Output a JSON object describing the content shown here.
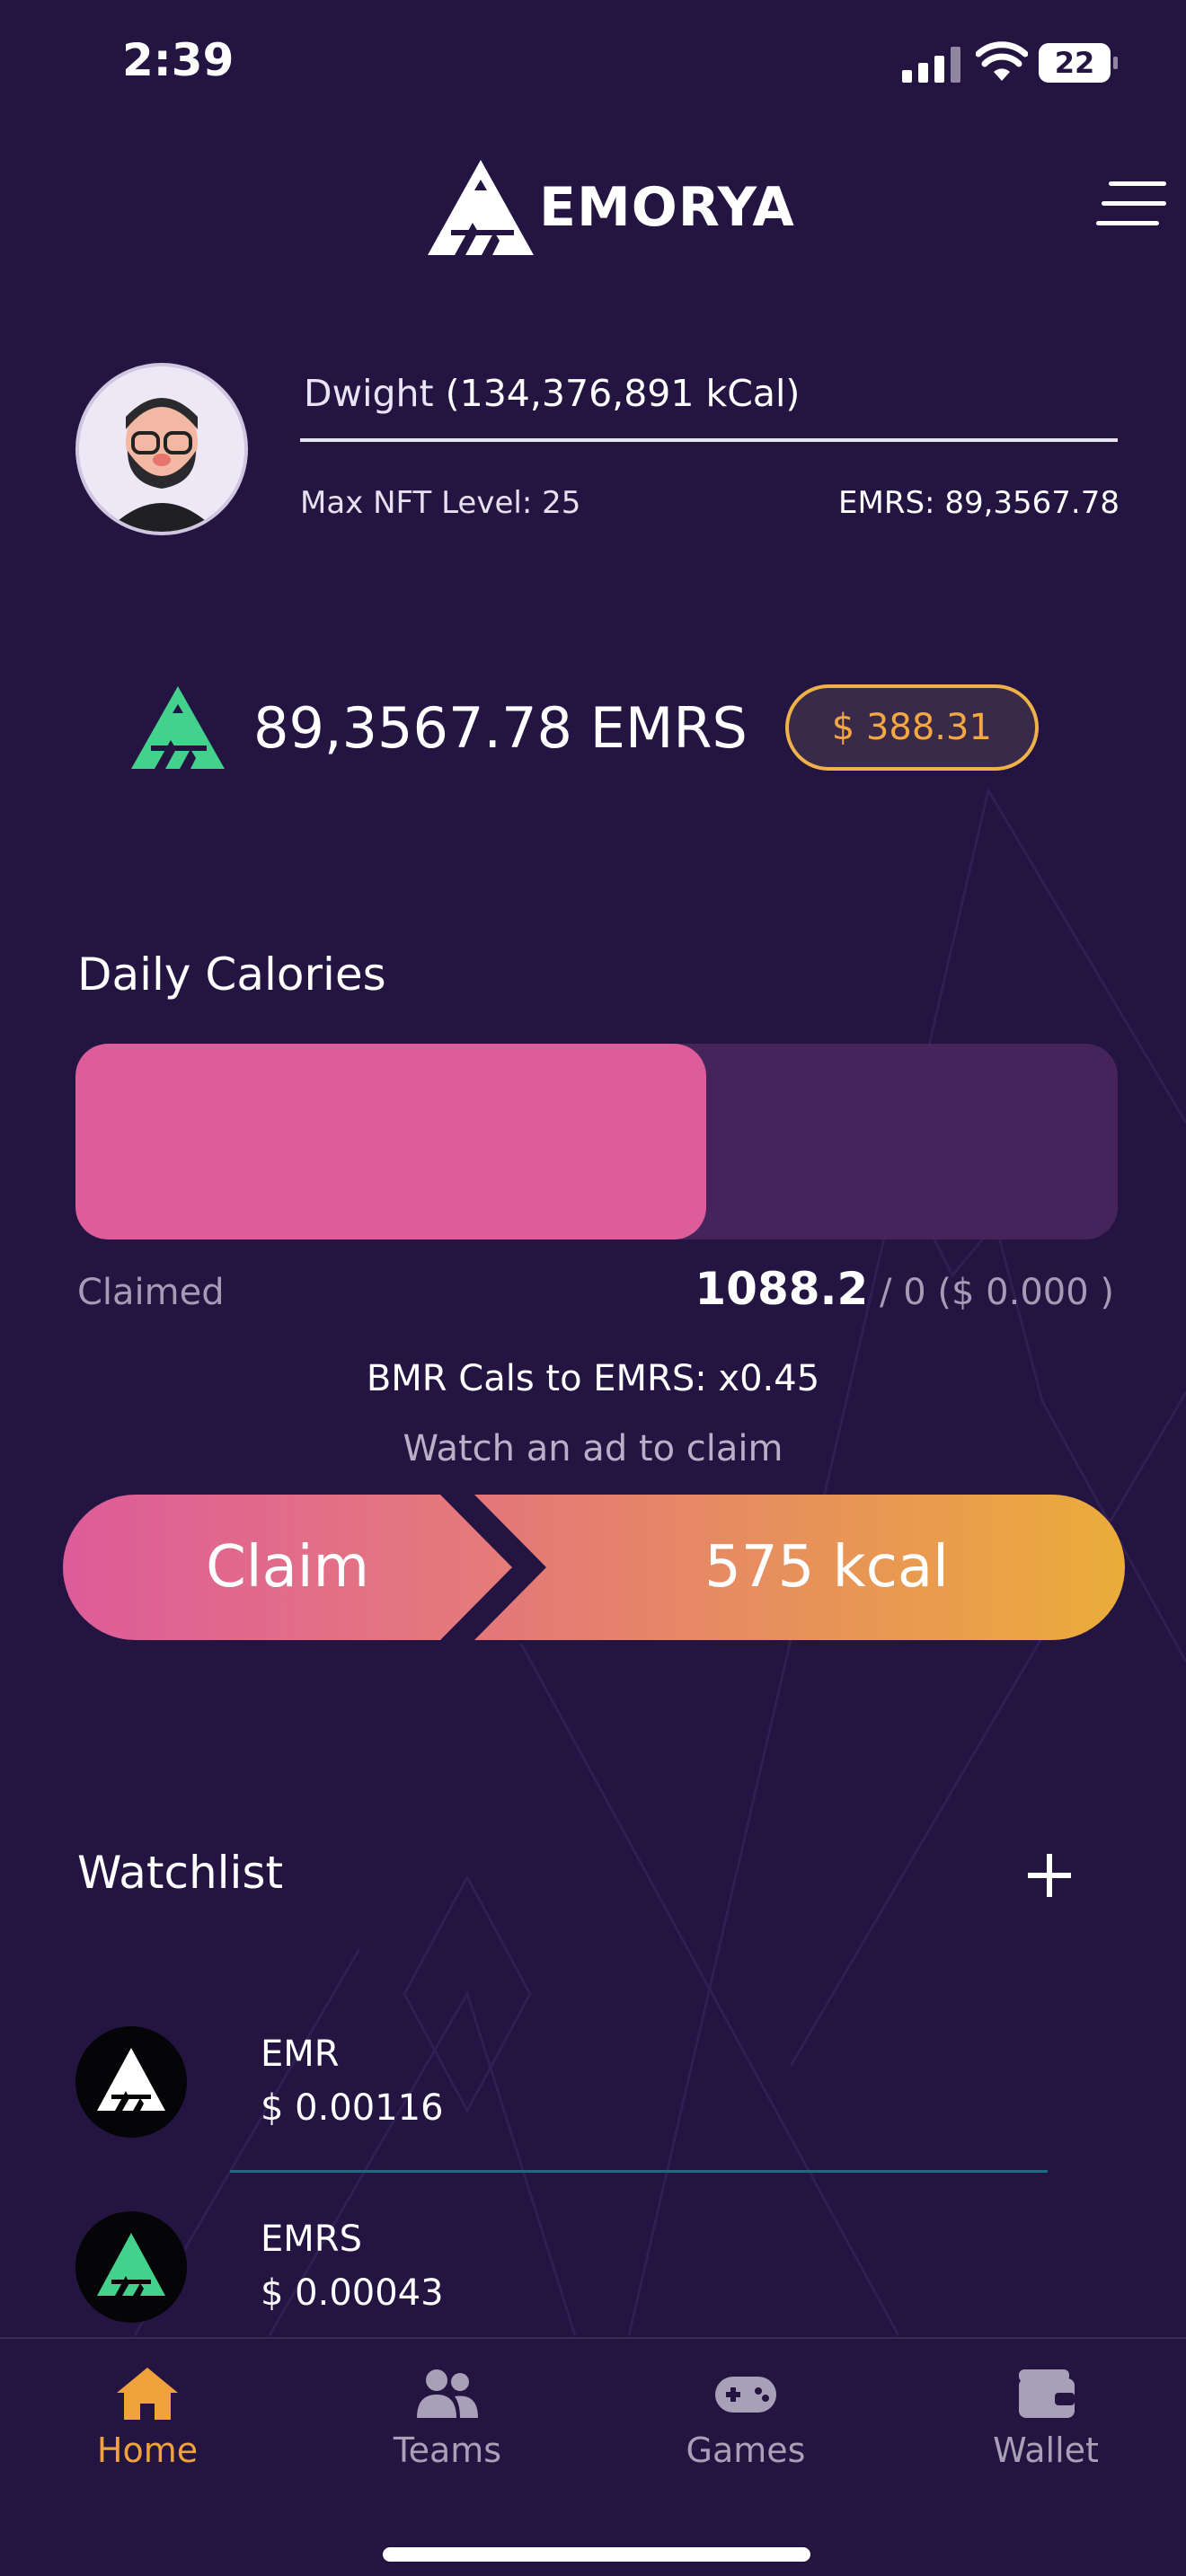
{
  "status_bar": {
    "time": "2:39",
    "battery": "22",
    "icons": [
      "cellular-signal-icon",
      "wifi-icon",
      "battery-icon"
    ]
  },
  "header": {
    "logo_text": "EMORYA",
    "menu_icon": "hamburger-menu-icon"
  },
  "profile": {
    "name": "Dwight",
    "calories": "(134,376,891 kCal)",
    "max_nft_level": "Max NFT Level: 25",
    "emrs": "EMRS: 89,3567.78"
  },
  "balance": {
    "amount": "89,3567.78 EMRS",
    "usd": "$ 388.31"
  },
  "daily_calories": {
    "title": "Daily Calories",
    "progress_fraction": 0.605,
    "claimed_label": "Claimed",
    "claimed_amount": "1088.2",
    "claimed_rest": "/ 0 ($ 0.000 )",
    "bmr_text": "BMR Cals to EMRS: x0.45",
    "watch_text": "Watch an ad to claim",
    "claim_label": "Claim",
    "kcal_label": "575 kcal"
  },
  "watchlist": {
    "title": "Watchlist",
    "items": [
      {
        "name": "EMR",
        "price": "$ 0.00116"
      },
      {
        "name": "EMRS",
        "price": "$ 0.00043"
      }
    ]
  },
  "tabbar": {
    "tabs": [
      {
        "label": "Home",
        "icon": "home-icon",
        "active": true
      },
      {
        "label": "Teams",
        "icon": "teams-icon",
        "active": false
      },
      {
        "label": "Games",
        "icon": "gamepad-icon",
        "active": false
      },
      {
        "label": "Wallet",
        "icon": "wallet-icon",
        "active": false
      }
    ]
  },
  "colors": {
    "background": "#231442",
    "accent_pink": "#dd5c9a",
    "accent_orange": "#f0a23c",
    "emrs_green": "#43d28c"
  }
}
